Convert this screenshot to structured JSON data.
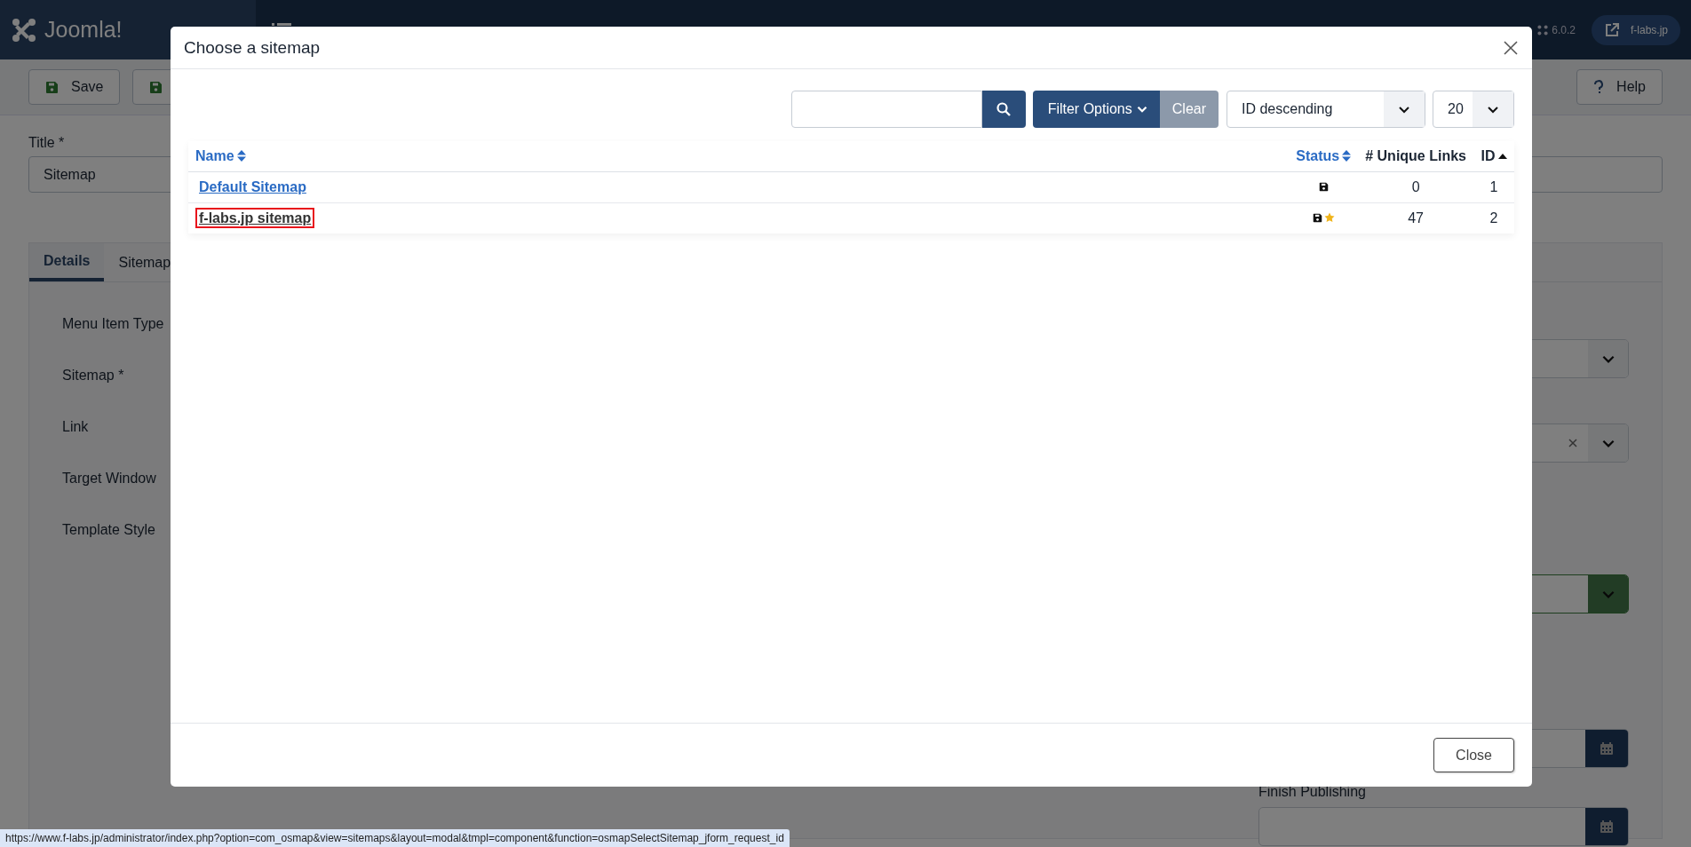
{
  "header": {
    "logo": "Joomla!",
    "version": "6.0.2",
    "site_button": "f-labs.jp"
  },
  "toolbar": {
    "buttons": [
      {
        "kind": "save",
        "label": "Save"
      },
      {
        "kind": "save-icon"
      }
    ],
    "help": "Help"
  },
  "form": {
    "title_label": "Title *",
    "title_value": "Sitemap",
    "tabs": [
      {
        "label": "Details",
        "selected": true
      },
      {
        "label": "Sitemap",
        "selected": false
      }
    ],
    "labels": [
      "Menu Item Type",
      "Sitemap *",
      "Link",
      "Target Window",
      "Template Style"
    ],
    "side_fields": [
      {
        "kind": "select"
      },
      {
        "kind": "select-clear"
      },
      {
        "kind": "select-valid"
      },
      {
        "kind": "date"
      },
      {
        "kind": "date",
        "label": "Finish Publishing"
      }
    ]
  },
  "modal": {
    "title": "Choose a sitemap",
    "filter_button": "Filter Options",
    "clear_button": "Clear",
    "ordering": "ID descending",
    "limit": "20",
    "columns": [
      {
        "label": "Name",
        "sorted": false
      },
      {
        "label": "Status",
        "sorted": false
      },
      {
        "label": "# Unique Links"
      },
      {
        "label": "ID",
        "sorted": true
      }
    ],
    "rows": [
      {
        "name": "Default Sitemap",
        "is_default": false,
        "links": "0",
        "id": "1",
        "highlighted": false
      },
      {
        "name": "f-labs.jp sitemap",
        "is_default": true,
        "links": "47",
        "id": "2",
        "highlighted": true
      }
    ],
    "close_button": "Close"
  },
  "status_bar": {
    "url": "https://www.f-labs.jp/administrator/index.php?option=com_osmap&view=sitemaps&layout=modal&tmpl=component&function=osmapSelectSitemap_jform_request_id"
  }
}
